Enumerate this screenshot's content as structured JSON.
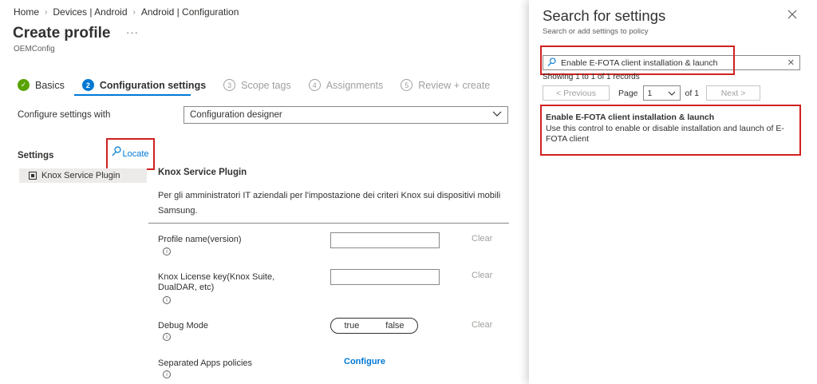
{
  "breadcrumb": [
    "Home",
    "Devices | Android",
    "Android | Configuration"
  ],
  "page": {
    "title": "Create profile",
    "more": "···",
    "subtitle": "OEMConfig"
  },
  "steps": [
    {
      "num": "✓",
      "label": "Basics",
      "state": "done"
    },
    {
      "num": "2",
      "label": "Configuration settings",
      "state": "active"
    },
    {
      "num": "3",
      "label": "Scope tags",
      "state": "todo"
    },
    {
      "num": "4",
      "label": "Assignments",
      "state": "todo"
    },
    {
      "num": "5",
      "label": "Review + create",
      "state": "todo"
    }
  ],
  "config": {
    "label": "Configure settings with",
    "value": "Configuration designer"
  },
  "settings": {
    "heading": "Settings",
    "locate": "Locate",
    "tree_item": "Knox Service Plugin"
  },
  "plugin": {
    "title": "Knox Service Plugin",
    "description": "Per gli amministratori IT aziendali per l'impostazione dei criteri Knox sui dispositivi mobili Samsung."
  },
  "fields": {
    "profile_name": "Profile name(version)",
    "license_key": "Knox License key(Knox Suite, DualDAR, etc)",
    "debug_mode": "Debug Mode",
    "separated_apps": "Separated Apps policies",
    "clear": "Clear",
    "toggle_true": "true",
    "toggle_false": "false",
    "configure": "Configure",
    "info": "i"
  },
  "search_panel": {
    "title": "Search for settings",
    "subtitle": "Search or add settings to policy",
    "query": "Enable E-FOTA client installation & launch",
    "records": "Showing 1 to 1 of 1 records",
    "previous": "< Previous",
    "page_label": "Page",
    "page_value": "1",
    "page_of": "of 1",
    "next": "Next >",
    "result_title": "Enable E-FOTA client installation & launch",
    "result_desc": "Use this control to enable or disable installation and launch of E-FOTA client"
  },
  "colors": {
    "accent": "#0078d4",
    "highlight": "#d02020",
    "success": "#57a300"
  }
}
